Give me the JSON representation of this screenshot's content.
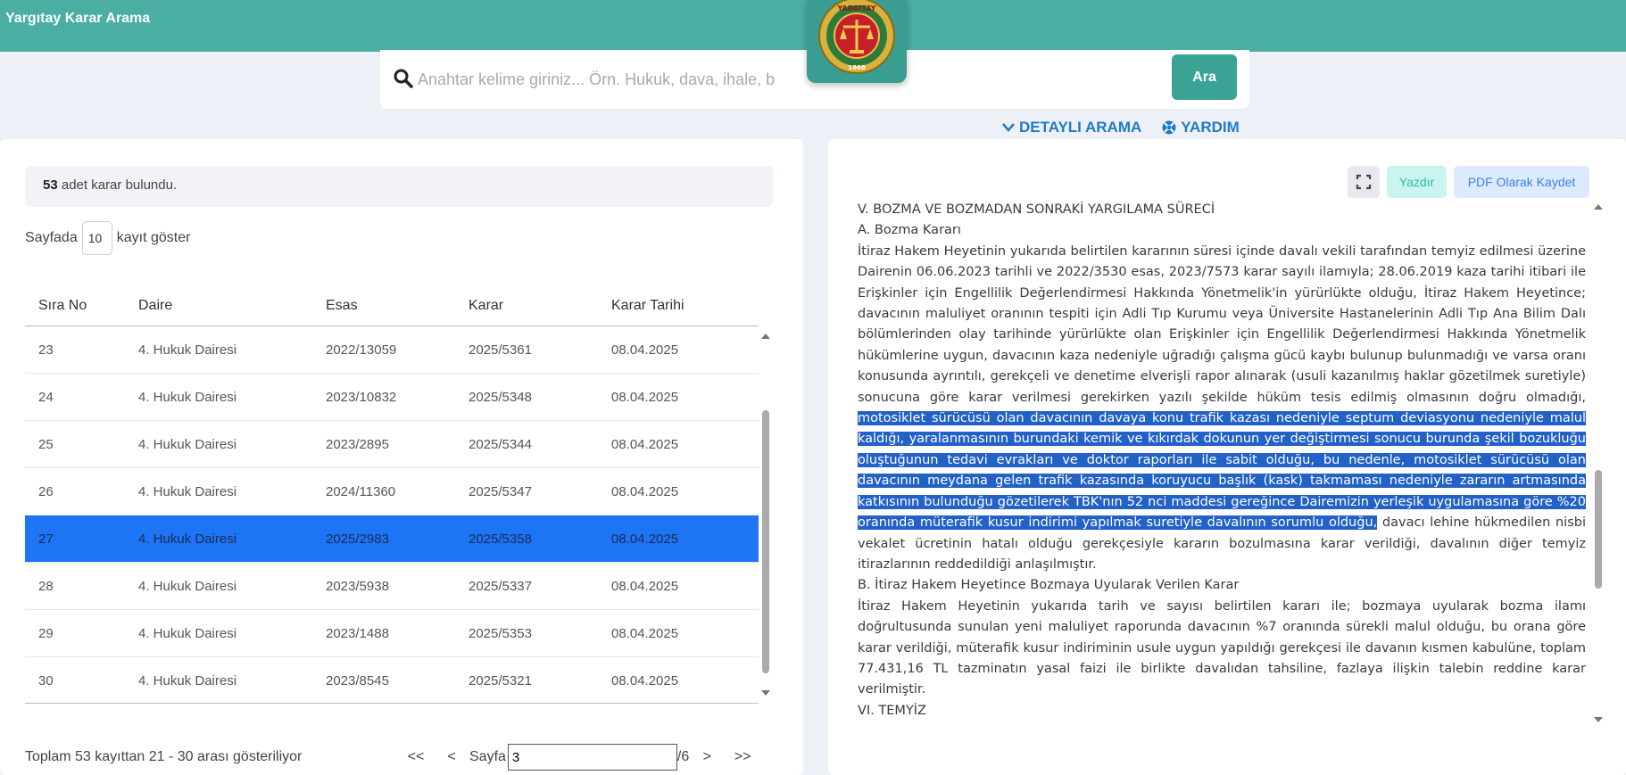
{
  "app": {
    "title": "Yargıtay Karar Arama"
  },
  "logo": {
    "text_top": "YARGITAY",
    "year": "1868"
  },
  "search": {
    "placeholder": "Anahtar kelime giriniz... Örn. Hukuk, dava, ihale, b",
    "button": "Ara"
  },
  "links": {
    "advanced": "DETAYLI ARAMA",
    "help": "YARDIM"
  },
  "results": {
    "count": "53",
    "count_suffix": "adet karar bulundu.",
    "per_page_prefix": "Sayfada",
    "per_page_value": "10",
    "per_page_suffix": "kayıt göster",
    "columns": [
      "Sıra No",
      "Daire",
      "Esas",
      "Karar",
      "Karar Tarihi"
    ],
    "rows": [
      [
        "23",
        "4. Hukuk Dairesi",
        "2022/13059",
        "2025/5361",
        "08.04.2025"
      ],
      [
        "24",
        "4. Hukuk Dairesi",
        "2023/10832",
        "2025/5348",
        "08.04.2025"
      ],
      [
        "25",
        "4. Hukuk Dairesi",
        "2023/2895",
        "2025/5344",
        "08.04.2025"
      ],
      [
        "26",
        "4. Hukuk Dairesi",
        "2024/11360",
        "2025/5347",
        "08.04.2025"
      ],
      [
        "27",
        "4. Hukuk Dairesi",
        "2025/2983",
        "2025/5358",
        "08.04.2025"
      ],
      [
        "28",
        "4. Hukuk Dairesi",
        "2023/5938",
        "2025/5337",
        "08.04.2025"
      ],
      [
        "29",
        "4. Hukuk Dairesi",
        "2023/1488",
        "2025/5353",
        "08.04.2025"
      ],
      [
        "30",
        "4. Hukuk Dairesi",
        "2023/8545",
        "2025/5321",
        "08.04.2025"
      ]
    ],
    "footer": "Toplam 53 kayıttan 21 - 30 arası gösteriliyor",
    "pager": {
      "first": "<<",
      "prev": "<",
      "label": "Sayfa",
      "page": "3",
      "total": "/6",
      "next": ">",
      "last": ">>"
    }
  },
  "document": {
    "toolbar": {
      "print": "Yazdır",
      "pdf": "PDF Olarak Kaydet"
    },
    "heading1": "V. BOZMA VE BOZMADAN SONRAKİ YARGILAMA SÜRECİ",
    "heading2": "A. Bozma Kararı",
    "para1_plain": "İtiraz Hakem Heyetinin yukarıda belirtilen kararının süresi içinde davalı vekili tarafından temyiz edilmesi üzerine Dairenin 06.06.2023 tarihli ve 2022/3530 esas, 2023/7573 karar sayılı ilamıyla; 28.06.2019 kaza tarihi itibari ile Erişkinler için Engellilik Değerlendirmesi Hakkında Yönetmelik'in yürürlükte olduğu, İtiraz Hakem Heyetince; davacının maluliyet oranının tespiti için Adli Tıp Kurumu veya Üniversite Hastanelerinin Adli Tıp Ana Bilim Dalı bölümlerinden olay tarihinde yürürlükte olan Erişkinler için Engellilik Değerlendirmesi Hakkında Yönetmelik hükümlerine uygun, davacının kaza nedeniyle uğradığı çalışma gücü kaybı bulunup bulunmadığı ve varsa oranı konusunda ayrıntılı, gerekçeli ve denetime elverişli rapor alınarak (usuli kazanılmış haklar gözetilmek suretiyle) sonucuna göre karar verilmesi gerekirken yazılı şekilde hüküm tesis edilmiş olmasının doğru olmadığı, ",
    "para1_highlight": "motosiklet sürücüsü olan davacının davaya konu trafik kazası nedeniyle septum deviasyonu nedeniyle malul kaldığı, yaralanmasının burundaki kemik ve kıkırdak dokunun yer değiştirmesi sonucu burunda şekil bozukluğu oluştuğunun tedavi evrakları ve doktor raporları ile sabit olduğu, bu nedenle, motosiklet sürücüsü olan davacının meydana gelen trafik kazasında koruyucu başlık (kask) takmaması nedeniyle zararın artmasında katkısının bulunduğu gözetilerek TBK'nın 52 nci maddesi gereğince Dairemizin yerleşik uygulamasına göre %20 oranında müterafik kusur indirimi yapılmak suretiyle davalının sorumlu olduğu,",
    "para1_tail": " davacı lehine hükmedilen nisbi vekalet ücretinin hatalı olduğu gerekçesiyle kararın bozulmasına karar verildiği, davalının diğer temyiz itirazlarının reddedildiği anlaşılmıştır.",
    "heading3": "B. İtiraz Hakem Heyetince Bozmaya Uyularak Verilen Karar",
    "para2": "İtiraz Hakem Heyetinin yukarıda tarih ve sayısı belirtilen kararı ile; bozmaya uyularak bozma ilamı doğrultusunda sunulan yeni maluliyet raporunda davacının %7 oranında sürekli malul olduğu, bu orana göre karar verildiği, müterafik kusur indiriminin usule uygun yapıldığı gerekçesi ile davanın kısmen kabulüne, toplam 77.431,16 TL tazminatın yasal faizi ile birlikte davalıdan tahsiline, fazlaya ilişkin talebin reddine karar verilmiştir.",
    "heading4": "VI. TEMYİZ"
  },
  "colors": {
    "header": "#4aaea3",
    "accent_blue": "#1d74f5",
    "link": "#1e7bc4",
    "highlight": "#2261c6"
  }
}
